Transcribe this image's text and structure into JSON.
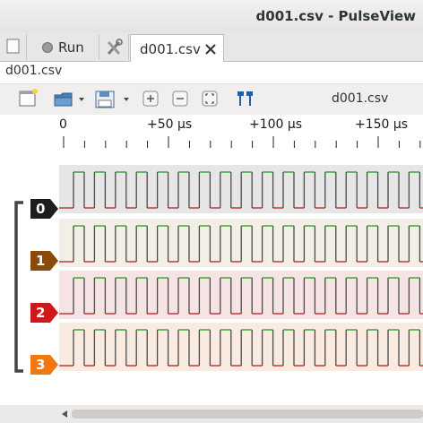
{
  "window": {
    "title": "d001.csv - PulseView"
  },
  "tabs": [
    {
      "label": ""
    },
    {
      "label": "Run"
    },
    {
      "label": ""
    },
    {
      "label": "d001.csv"
    }
  ],
  "file_label": "d001.csv",
  "toolbar": {
    "device_label": "d001.csv"
  },
  "ruler": {
    "ticks": [
      "0",
      "+50 µs",
      "+100 µs",
      "+150 µs"
    ]
  },
  "channels": [
    {
      "label": "0",
      "color": "#1e1e1e",
      "bg": "#e6e6e6"
    },
    {
      "label": "1",
      "color": "#8b4a0a",
      "bg": "#f4efe6"
    },
    {
      "label": "2",
      "color": "#d01818",
      "bg": "#f6e4e4"
    },
    {
      "label": "3",
      "color": "#f07810",
      "bg": "#f9ebe0"
    }
  ],
  "colors": {
    "high": "#1a9a1a",
    "low": "#b01a1a",
    "group_bracket": "#444444"
  }
}
